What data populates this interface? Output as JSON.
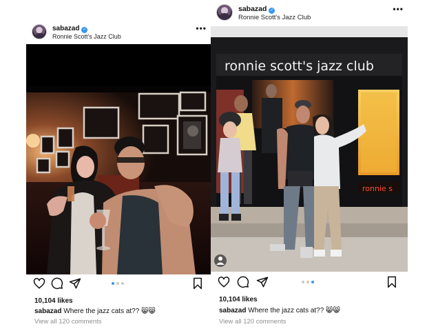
{
  "posts": [
    {
      "username": "sabazad",
      "location": "Ronnie Scott's Jazz Club",
      "likes": "10,104 likes",
      "caption_user": "sabazad",
      "caption_text": "Where the jazz cats at?? 😸😸",
      "comments_link": "View all 120 comments",
      "carousel": {
        "count": 3,
        "active": 0
      }
    },
    {
      "username": "sabazad",
      "location": "Ronnie Scott's Jazz Club",
      "likes": "10,104 likes",
      "caption_user": "sabazad",
      "caption_text": "Where the jazz cats at?? 😸😸",
      "comments_link": "View all 120 comments",
      "carousel": {
        "count": 3,
        "active": 2
      },
      "signage": {
        "awning": "ronnie scott's jazz club",
        "window": "ronnie s"
      }
    }
  ],
  "icons": {
    "verified": "verified-badge-icon",
    "more": "more-options-icon",
    "like": "heart-icon",
    "comment": "comment-icon",
    "share": "share-icon",
    "save": "bookmark-icon"
  },
  "colors": {
    "verified": "#3897f0",
    "carousel_active": "#3897f0",
    "carousel_inactive": "#c9c9c9",
    "muted_text": "#8e8e8e"
  }
}
